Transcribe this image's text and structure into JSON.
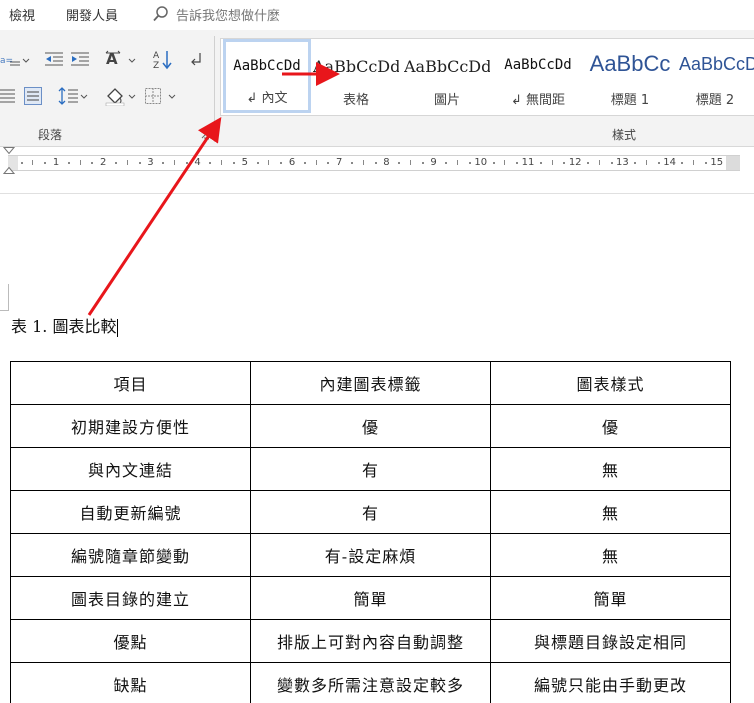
{
  "menu": {
    "items": [
      "檢視",
      "開發人員"
    ],
    "tell_me": "告訴我您想做什麼"
  },
  "ribbon": {
    "groups": {
      "paragraph": "段落",
      "styles": "樣式"
    },
    "style_gallery": [
      {
        "sample": "AaBbCcDd",
        "name": "↲ 內文",
        "selected": true
      },
      {
        "sample": "AaBbCcDd",
        "name": "表格",
        "selected": false
      },
      {
        "sample": "AaBbCcDd",
        "name": "圖片",
        "selected": false
      },
      {
        "sample": "AaBbCcDd",
        "name": "↲ 無間距",
        "selected": false
      },
      {
        "sample": "AaBbCc",
        "name": "標題 1",
        "selected": false
      },
      {
        "sample": "AaBbCcD",
        "name": "標題 2",
        "selected": false
      }
    ]
  },
  "ruler": {
    "ticks": [
      "1",
      "2",
      "3",
      "4",
      "5",
      "6",
      "7",
      "8",
      "9",
      "10",
      "11",
      "12",
      "13",
      "14",
      "15"
    ]
  },
  "document": {
    "caption": "表 1. 圖表比較",
    "table": {
      "headers": [
        "項目",
        "內建圖表標籤",
        "圖表樣式"
      ],
      "rows": [
        [
          "初期建設方便性",
          "優",
          "優"
        ],
        [
          "與內文連結",
          "有",
          "無"
        ],
        [
          "自動更新編號",
          "有",
          "無"
        ],
        [
          "編號隨章節變動",
          "有-設定麻煩",
          "無"
        ],
        [
          "圖表目錄的建立",
          "簡單",
          "簡單"
        ],
        [
          "優點",
          "排版上可對內容自動調整",
          "與標題目錄設定相同"
        ],
        [
          "缺點",
          "變數多所需注意設定較多",
          "編號只能由手動更改"
        ]
      ]
    }
  },
  "colors": {
    "annotation_arrow": "#e8161b",
    "heading_style_blue": "#2f5496",
    "selected_style_border": "#bcd3f0"
  },
  "icons": [
    "search-icon",
    "bullets-icon",
    "decrease-indent-icon",
    "increase-indent-icon",
    "text-direction-icon",
    "sort-icon",
    "show-marks-icon",
    "align-justify-icon",
    "distributed-icon",
    "line-spacing-icon",
    "shading-icon",
    "borders-icon",
    "dropdown-chevron-icon",
    "dialog-launcher-icon"
  ]
}
